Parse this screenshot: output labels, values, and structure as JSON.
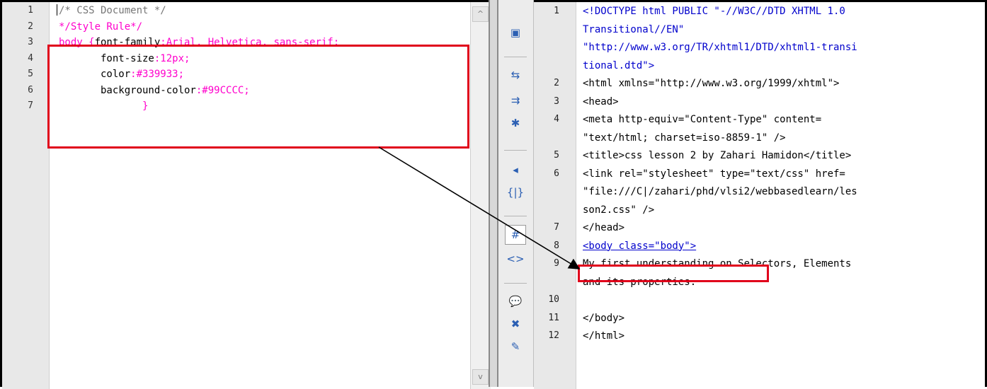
{
  "left_editor": {
    "line_numbers": [
      "1",
      "2",
      "3",
      "4",
      "5",
      "6",
      "7"
    ],
    "lines": [
      [
        {
          "t": "/* CSS Document */",
          "c": "c-comment"
        }
      ],
      [
        {
          "t": "*/Style Rule*/",
          "c": "c-magenta"
        }
      ],
      [
        {
          "t": "body {",
          "c": "c-magenta"
        },
        {
          "t": "font-family",
          "c": "c-black"
        },
        {
          "t": ":Arial, Helvetica, sans-serif;",
          "c": "c-magenta"
        }
      ],
      [
        {
          "t": "       font-size",
          "c": "c-black"
        },
        {
          "t": ":12px;",
          "c": "c-magenta"
        }
      ],
      [
        {
          "t": "       color",
          "c": "c-black"
        },
        {
          "t": ":#339933;",
          "c": "c-magenta"
        }
      ],
      [
        {
          "t": "       background-color",
          "c": "c-black"
        },
        {
          "t": ":#99CCCC;",
          "c": "c-magenta"
        }
      ],
      [
        {
          "t": "              }",
          "c": "c-magenta"
        }
      ]
    ],
    "scroll_up": "^",
    "scroll_down": "v"
  },
  "toolbar": {
    "icons": [
      "file-options-icon",
      "collapse-full-tag-icon",
      "collapse-selection-icon",
      "expand-all-icon",
      "select-parent-tag-icon",
      "balance-braces-icon",
      "line-numbers-icon",
      "highlight-invalid-code-icon",
      "apply-comment-icon",
      "remove-comment-icon",
      "format-source-icon"
    ],
    "glyphs": [
      "▣",
      "⇆",
      "⇉",
      "✱",
      "◂",
      "{|}",
      "#",
      "<>",
      "💬",
      "✖",
      "✎"
    ]
  },
  "right_editor": {
    "rows": [
      {
        "n": "1",
        "t": "<!DOCTYPE html PUBLIC \"-//W3C//DTD XHTML 1.0"
      },
      {
        "n": "",
        "t": "Transitional//EN\""
      },
      {
        "n": "",
        "t": "\"http://www.w3.org/TR/xhtml1/DTD/xhtml1-transi"
      },
      {
        "n": "",
        "t": "tional.dtd\">"
      },
      {
        "n": "2",
        "t": "<html xmlns=\"http://www.w3.org/1999/xhtml\">"
      },
      {
        "n": "3",
        "t": "<head>"
      },
      {
        "n": "4",
        "t": "<meta http-equiv=\"Content-Type\" content="
      },
      {
        "n": "",
        "t": "\"text/html; charset=iso-8859-1\" />"
      },
      {
        "n": "5",
        "t": "<title>css lesson 2 by Zahari Hamidon</title>"
      },
      {
        "n": "6",
        "t": "<link rel=\"stylesheet\" type=\"text/css\" href="
      },
      {
        "n": "",
        "t": "\"file:///C|/zahari/phd/vlsi2/webbasedlearn/les"
      },
      {
        "n": "",
        "t": "son2.css\" />"
      },
      {
        "n": "7",
        "t": "</head>"
      },
      {
        "n": "8",
        "t": "<body class=\"body\">"
      },
      {
        "n": "9",
        "t": "My first understanding on Selectors, Elements"
      },
      {
        "n": "",
        "t": "and its properties."
      },
      {
        "n": "10",
        "t": ""
      },
      {
        "n": "11",
        "t": "</body>"
      },
      {
        "n": "12",
        "t": "</html>"
      }
    ]
  },
  "colors": {
    "highlight": "#e0001b",
    "arrow": "#000000"
  }
}
